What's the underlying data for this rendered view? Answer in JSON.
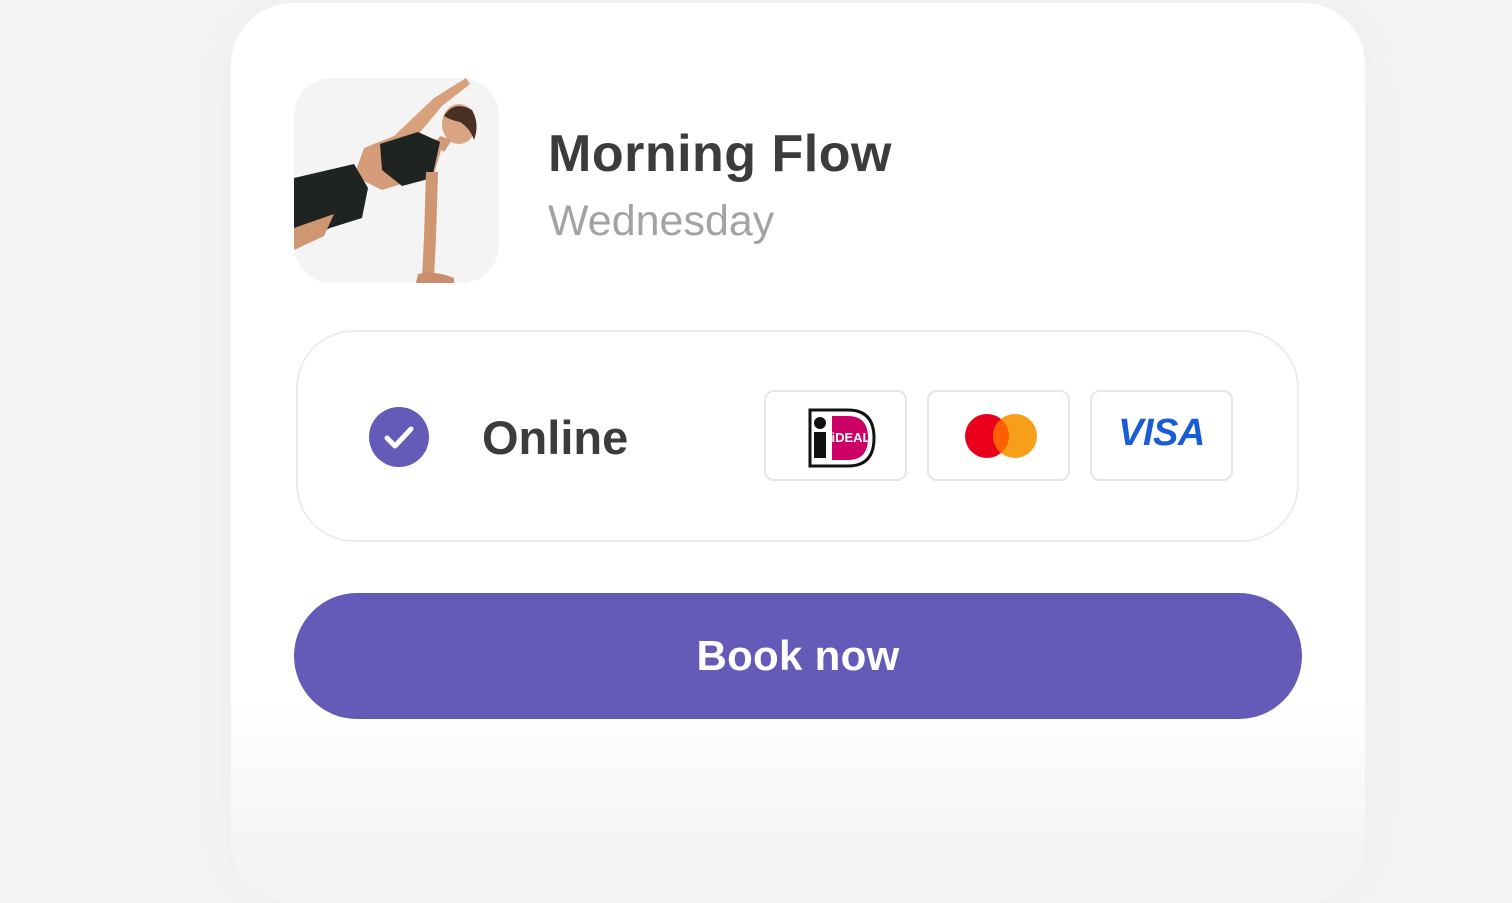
{
  "session": {
    "title": "Morning Flow",
    "day": "Wednesday",
    "image_alt": "woman-side-plank-photo"
  },
  "payment": {
    "selected": true,
    "method_label": "Online",
    "methods": [
      {
        "name": "ideal",
        "label": "iDEAL"
      },
      {
        "name": "mastercard",
        "label": ""
      },
      {
        "name": "visa",
        "label": "VISA"
      }
    ]
  },
  "actions": {
    "book_label": "Book now"
  },
  "colors": {
    "accent": "#635bb7",
    "title": "#3c3c3e",
    "subtitle": "#a3a3a5",
    "visa_blue": "#1a5bd6",
    "mastercard_red": "#eb001b",
    "mastercard_orange": "#f79e1b",
    "ideal_pink": "#cc0066"
  },
  "icons": {
    "check": "check-icon",
    "ideal": "ideal-logo-icon",
    "mastercard": "mastercard-logo-icon",
    "visa": "visa-logo-icon"
  }
}
